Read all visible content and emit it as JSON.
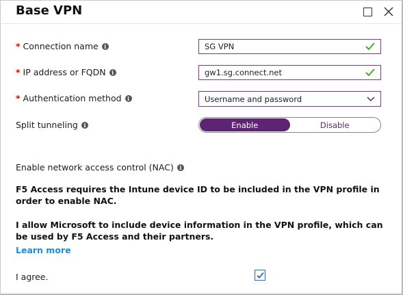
{
  "window": {
    "title": "Base VPN"
  },
  "form": {
    "connection_name": {
      "label": "Connection name",
      "required_mark": "*",
      "value": "SG VPN"
    },
    "ip_address": {
      "label": "IP address or FQDN",
      "required_mark": "*",
      "value": "gw1.sg.connect.net"
    },
    "auth_method": {
      "label": "Authentication method",
      "required_mark": "*",
      "value": "Username and password"
    },
    "split_tunneling": {
      "label": "Split tunneling",
      "options": [
        "Enable",
        "Disable"
      ],
      "selected": "Enable"
    },
    "nac": {
      "label": "Enable network access control (NAC)"
    }
  },
  "notice": {
    "para1": "F5 Access requires the Intune device ID to be included in the VPN profile in order to enable NAC.",
    "para2": "I allow Microsoft to include device information in the VPN profile, which can be used by F5 Access and their partners.",
    "learn_more": "Learn more"
  },
  "agree": {
    "label": "I agree.",
    "checked": true
  },
  "colors": {
    "accent": "#5c2473",
    "field_border": "#7a3b8f",
    "valid_check": "#4aa82d",
    "link": "#1b8fd6",
    "required": "#e00000"
  }
}
